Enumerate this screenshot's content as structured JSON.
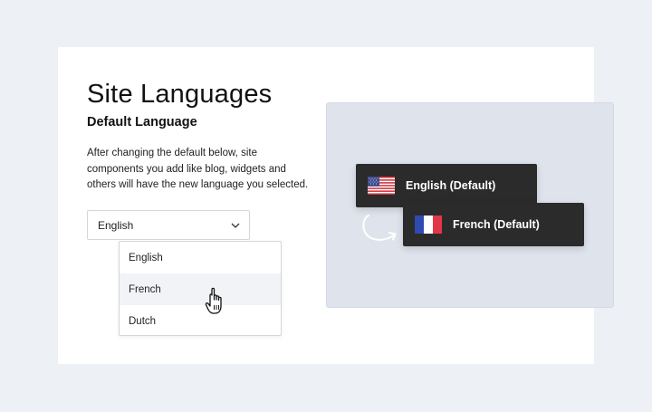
{
  "page": {
    "title": "Site Languages",
    "subtitle": "Default Language",
    "description": "After changing the default below, site components you add like blog, widgets and others will have the new language you selected."
  },
  "language_select": {
    "value": "English",
    "options": [
      "English",
      "French",
      "Dutch"
    ],
    "hovered_option": "French"
  },
  "preview": {
    "cards": [
      {
        "label": "English (Default)",
        "flag": "us-flag-icon"
      },
      {
        "label": "French (Default)",
        "flag": "fr-flag-icon"
      }
    ],
    "colors": {
      "card_bg": "#2b2b2b",
      "panel_bg": "#dfe3ec",
      "page_bg": "#edf0f4"
    }
  }
}
